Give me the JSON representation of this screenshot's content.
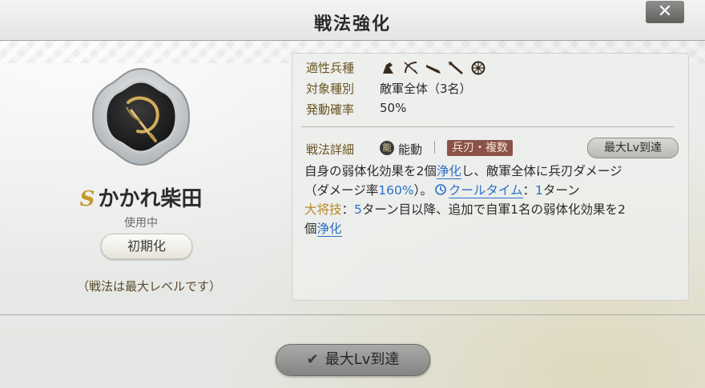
{
  "header": {
    "title": "戦法強化",
    "close_label": "✕"
  },
  "skill": {
    "rank": "S",
    "name": "かかれ柴田",
    "status": "使用中",
    "reset_label": "初期化",
    "max_note": "（戦法は最大レベルです）"
  },
  "info": {
    "unit_label": "適性兵種",
    "unit_icons": [
      "cavalry-icon",
      "archer-icon",
      "gun-icon",
      "spear-icon",
      "wheel-icon"
    ],
    "target_label": "対象種別",
    "target_value": "敵軍全体（3名）",
    "rate_label": "発動確率",
    "rate_value": "50%",
    "detail_label": "戦法詳細",
    "type_icon_char": "能",
    "type_value": "能動",
    "tag": "兵刃・複数",
    "maxlv_badge": "最大Lv到達"
  },
  "description": {
    "l1_a": "自身の弱体化効果を2個",
    "l1_kw": "浄化",
    "l1_b": "し、敵軍全体に兵刃ダメージ",
    "l2_a": "（ダメージ率",
    "l2_num": "160%",
    "l2_b": "）。",
    "l2_kw": "クールタイム",
    "l2_c": "：",
    "l2_num2": "1",
    "l2_d": "ターン",
    "l3_label": "大将技",
    "l3_a": "：",
    "l3_num": "5",
    "l3_b": "ターン目以降、追加で自軍1名の弱体化効果を2",
    "l4_a": "個",
    "l4_kw": "浄化"
  },
  "footer": {
    "button_label": "最大Lv到達"
  },
  "colors": {
    "accent_blue": "#2b6fc7",
    "gold": "#b8892a",
    "tag_bg": "#8a5248"
  }
}
